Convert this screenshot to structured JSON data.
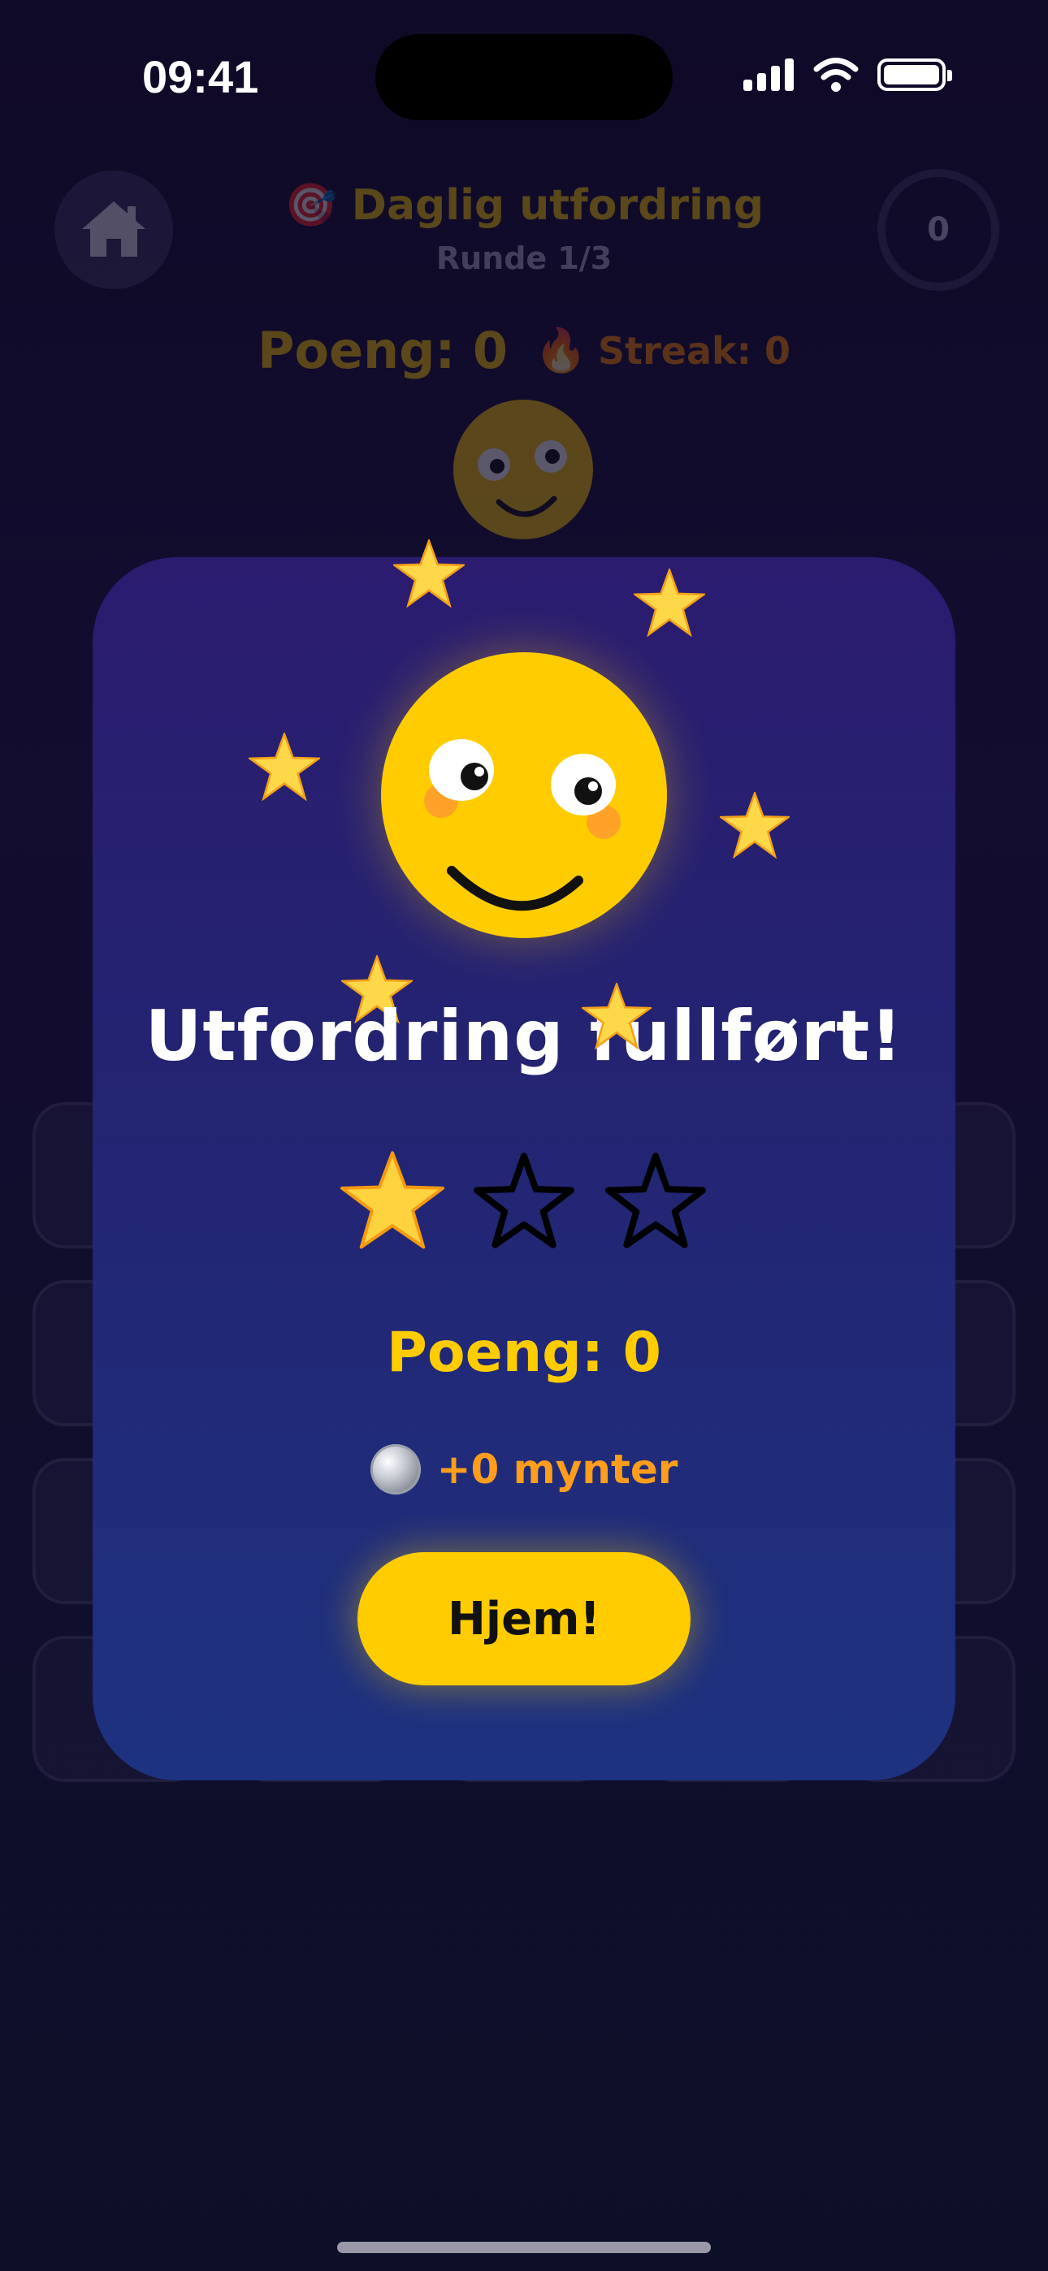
{
  "status_bar": {
    "time": "09:41"
  },
  "header": {
    "title": "Daglig utfordring",
    "title_icon": "🎯",
    "round": "Runde 1/3",
    "timer": "0"
  },
  "score_bar": {
    "score": "Poeng: 0",
    "streak_icon": "🔥",
    "streak": "Streak: 0"
  },
  "modal": {
    "title": "Utfordring fullført!",
    "stars_earned": 1,
    "stars_total": 3,
    "score": "Poeng: 0",
    "coins": "+0 mynter",
    "button_label": "Hjem!"
  },
  "colors": {
    "accent_yellow": "#ffcc00",
    "coins_orange": "#ff9d1c",
    "modal_top": "#2b1c70",
    "modal_bottom": "#1d3280"
  }
}
